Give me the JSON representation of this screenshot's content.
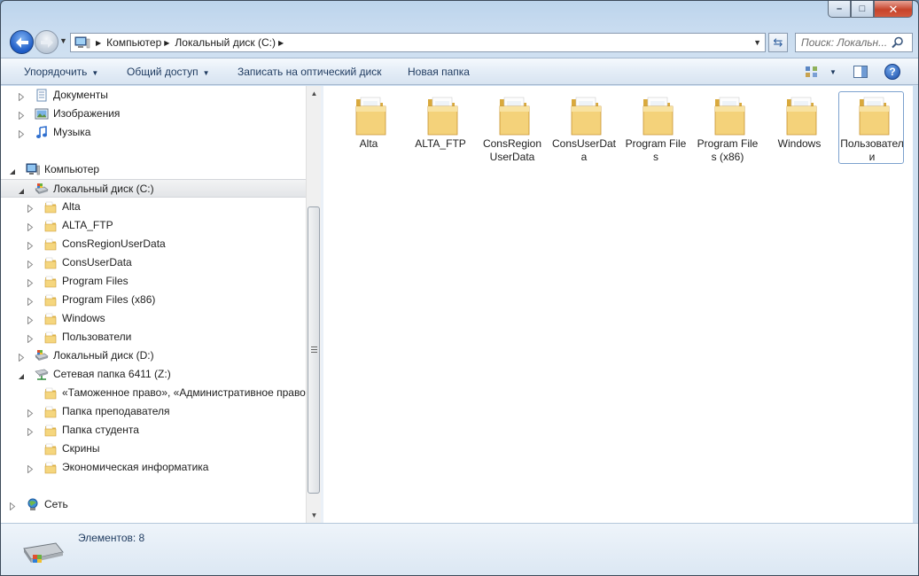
{
  "window": {
    "minimize": "–",
    "maximize": "□",
    "close": "✕"
  },
  "address": {
    "crumbs": [
      "Компьютер",
      "Локальный диск (C:)"
    ],
    "refresh_icon": "refresh-icon"
  },
  "search": {
    "placeholder": "Поиск: Локальн..."
  },
  "toolbar": {
    "organize": "Упорядочить",
    "share": "Общий доступ",
    "burn": "Записать на оптический диск",
    "new_folder": "Новая папка",
    "help": "?"
  },
  "tree": [
    {
      "label": "Документы",
      "icon": "documents-icon"
    },
    {
      "label": "Изображения",
      "icon": "pictures-icon"
    },
    {
      "label": "Музыка",
      "icon": "music-icon"
    },
    {
      "label": "Компьютер",
      "icon": "computer-icon"
    },
    {
      "label": "Локальный диск (C:)",
      "icon": "drive-icon",
      "selected": true
    },
    {
      "label": "Alta",
      "icon": "folder-icon"
    },
    {
      "label": "ALTA_FTP",
      "icon": "folder-icon"
    },
    {
      "label": "ConsRegionUserData",
      "icon": "folder-icon"
    },
    {
      "label": "ConsUserData",
      "icon": "folder-icon"
    },
    {
      "label": "Program Files",
      "icon": "folder-icon"
    },
    {
      "label": "Program Files (x86)",
      "icon": "folder-icon"
    },
    {
      "label": "Windows",
      "icon": "folder-icon"
    },
    {
      "label": "Пользователи",
      "icon": "folder-icon"
    },
    {
      "label": "Локальный диск (D:)",
      "icon": "drive-icon"
    },
    {
      "label": "Сетевая папка 6411 (Z:)",
      "icon": "network-drive-icon"
    },
    {
      "label": "«Таможенное право», «Административное право»",
      "icon": "folder-icon"
    },
    {
      "label": "Папка преподавателя",
      "icon": "folder-icon"
    },
    {
      "label": "Папка студента",
      "icon": "folder-icon"
    },
    {
      "label": "Скрины",
      "icon": "folder-icon"
    },
    {
      "label": "Экономическая информатика",
      "icon": "folder-icon"
    },
    {
      "label": "Сеть",
      "icon": "network-icon"
    }
  ],
  "content": {
    "items": [
      {
        "label": "Alta"
      },
      {
        "label": "ALTA_FTP"
      },
      {
        "label": "ConsRegionUserData"
      },
      {
        "label": "ConsUserData"
      },
      {
        "label": "Program Files"
      },
      {
        "label": "Program Files (x86)"
      },
      {
        "label": "Windows"
      },
      {
        "label": "Пользователи"
      }
    ]
  },
  "details": {
    "count_label": "Элементов: 8"
  },
  "colors": {
    "folder": "#f2d37a",
    "folder_dark": "#d9a93c",
    "selection_border": "#7da2ce",
    "command_text": "#1e3a5f"
  }
}
